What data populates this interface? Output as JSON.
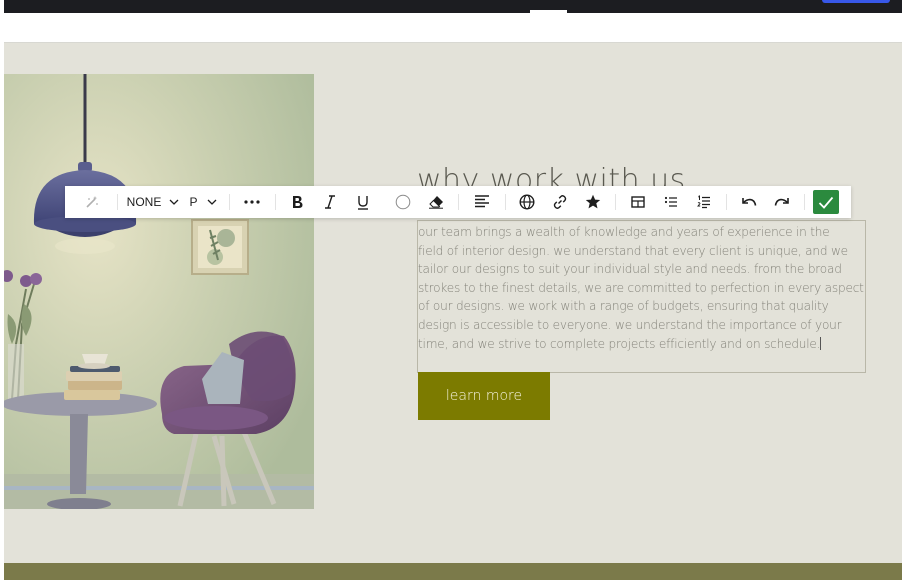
{
  "colors": {
    "editor_bar": "#1c1d21",
    "page_background": "#e3e2d9",
    "accent_olive": "#7c7b00",
    "footer_olive": "#7b7a4a",
    "save_green": "#2b8a3e",
    "publish_blue": "#3858e9"
  },
  "toolbar": {
    "magic_icon": "wand-icon",
    "font_size_value": "NONE",
    "block_type_value": "P",
    "more_icon": "ellipsis-icon",
    "bold_icon": "bold-icon",
    "italic_icon": "italic-icon",
    "underline_icon": "underline-icon",
    "color_icon": "text-color-icon",
    "clear_icon": "eraser-icon",
    "align_icon": "align-left-icon",
    "globe_icon": "globe-icon",
    "link_icon": "link-icon",
    "star_icon": "star-icon",
    "table_icon": "table-icon",
    "bullet_list_icon": "bullet-list-icon",
    "numbered_list_icon": "numbered-list-icon",
    "undo_icon": "undo-icon",
    "redo_icon": "redo-icon",
    "save_icon": "check-icon"
  },
  "section": {
    "heading": "why work with us",
    "paragraph_lines": [
      "our team brings a wealth of knowledge and years of experience in the",
      "field of interior design. we understand that every client is unique, and we",
      "tailor our designs to suit your individual style and needs. from the broad",
      "strokes to the finest details, we are committed to perfection in every aspect",
      "of our designs. we work with a range of budgets, ensuring that quality",
      "design is accessible to everyone. we understand the importance of your",
      "time, and we strive to complete projects efficiently and on schedule."
    ],
    "cta_label": "learn more"
  }
}
